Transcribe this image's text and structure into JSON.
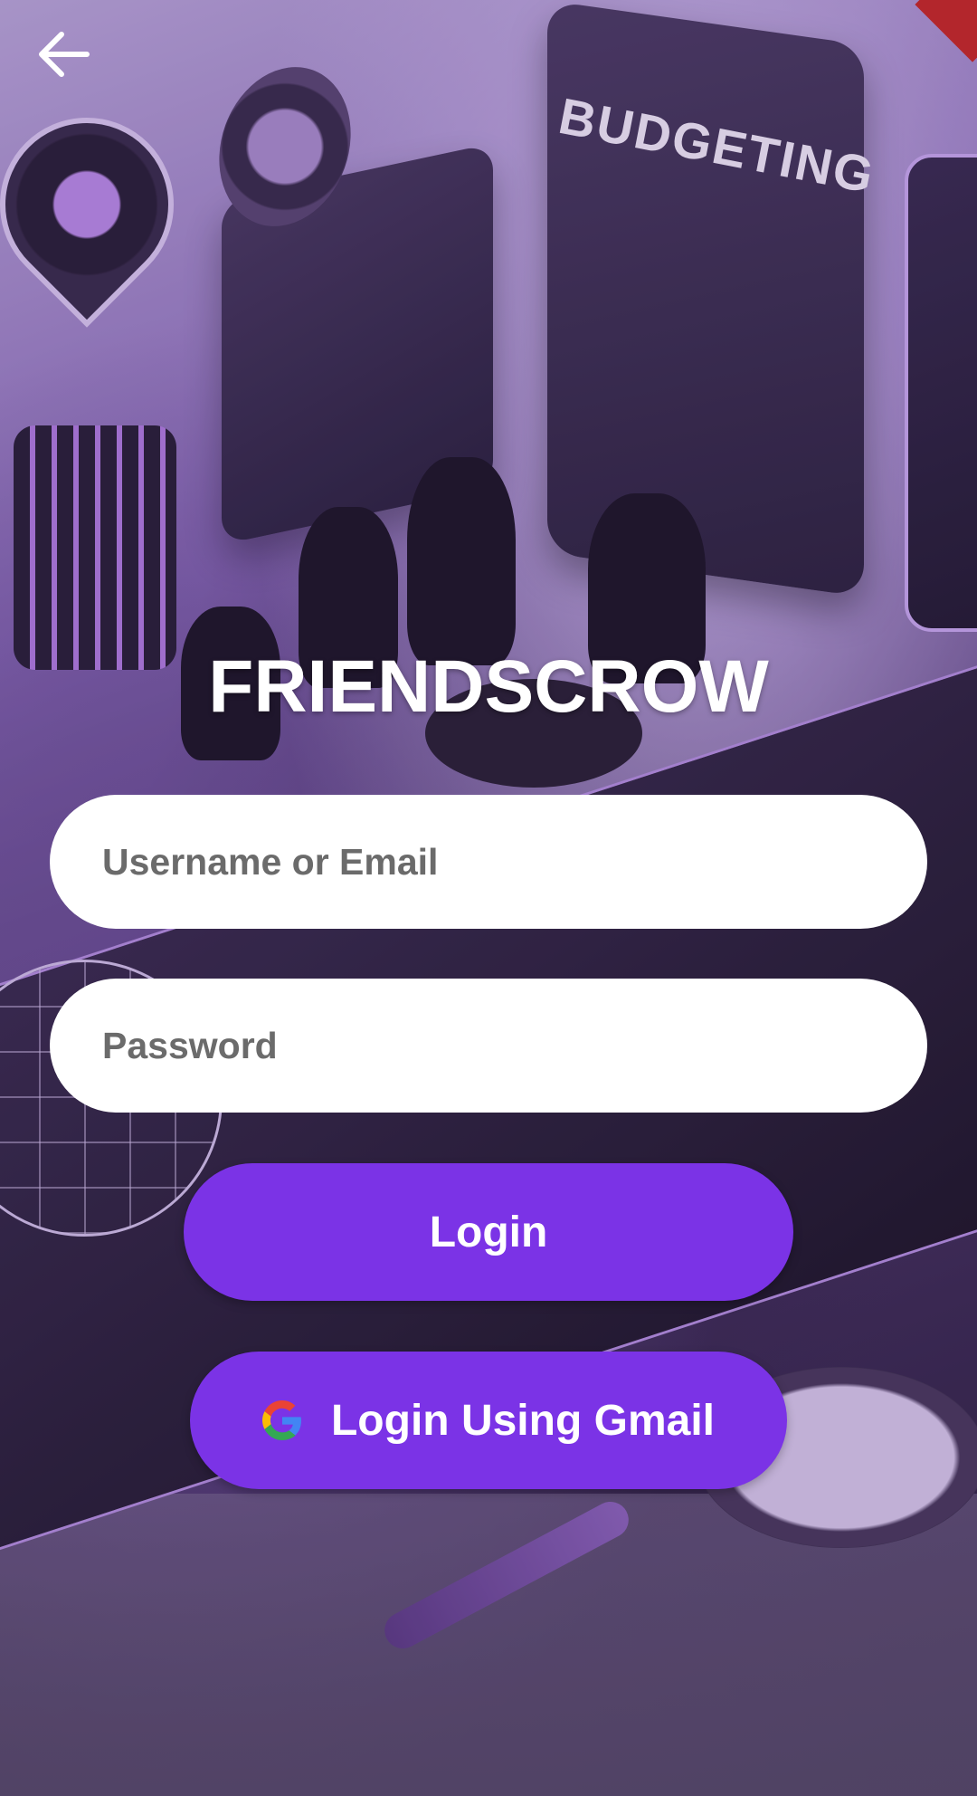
{
  "header": {
    "back_icon": "arrow-left-icon"
  },
  "app": {
    "title": "FRIENDSCROW"
  },
  "form": {
    "username_placeholder": "Username or Email",
    "username_value": "",
    "password_placeholder": "Password",
    "password_value": ""
  },
  "buttons": {
    "login_label": "Login",
    "gmail_label": "Login Using Gmail",
    "gmail_icon": "google-icon"
  },
  "background": {
    "sign_text": "BUDGETING"
  },
  "colors": {
    "accent": "#7b33e6",
    "field_bg": "#ffffff",
    "title": "#ffffff",
    "placeholder": "#6b6b6b"
  }
}
